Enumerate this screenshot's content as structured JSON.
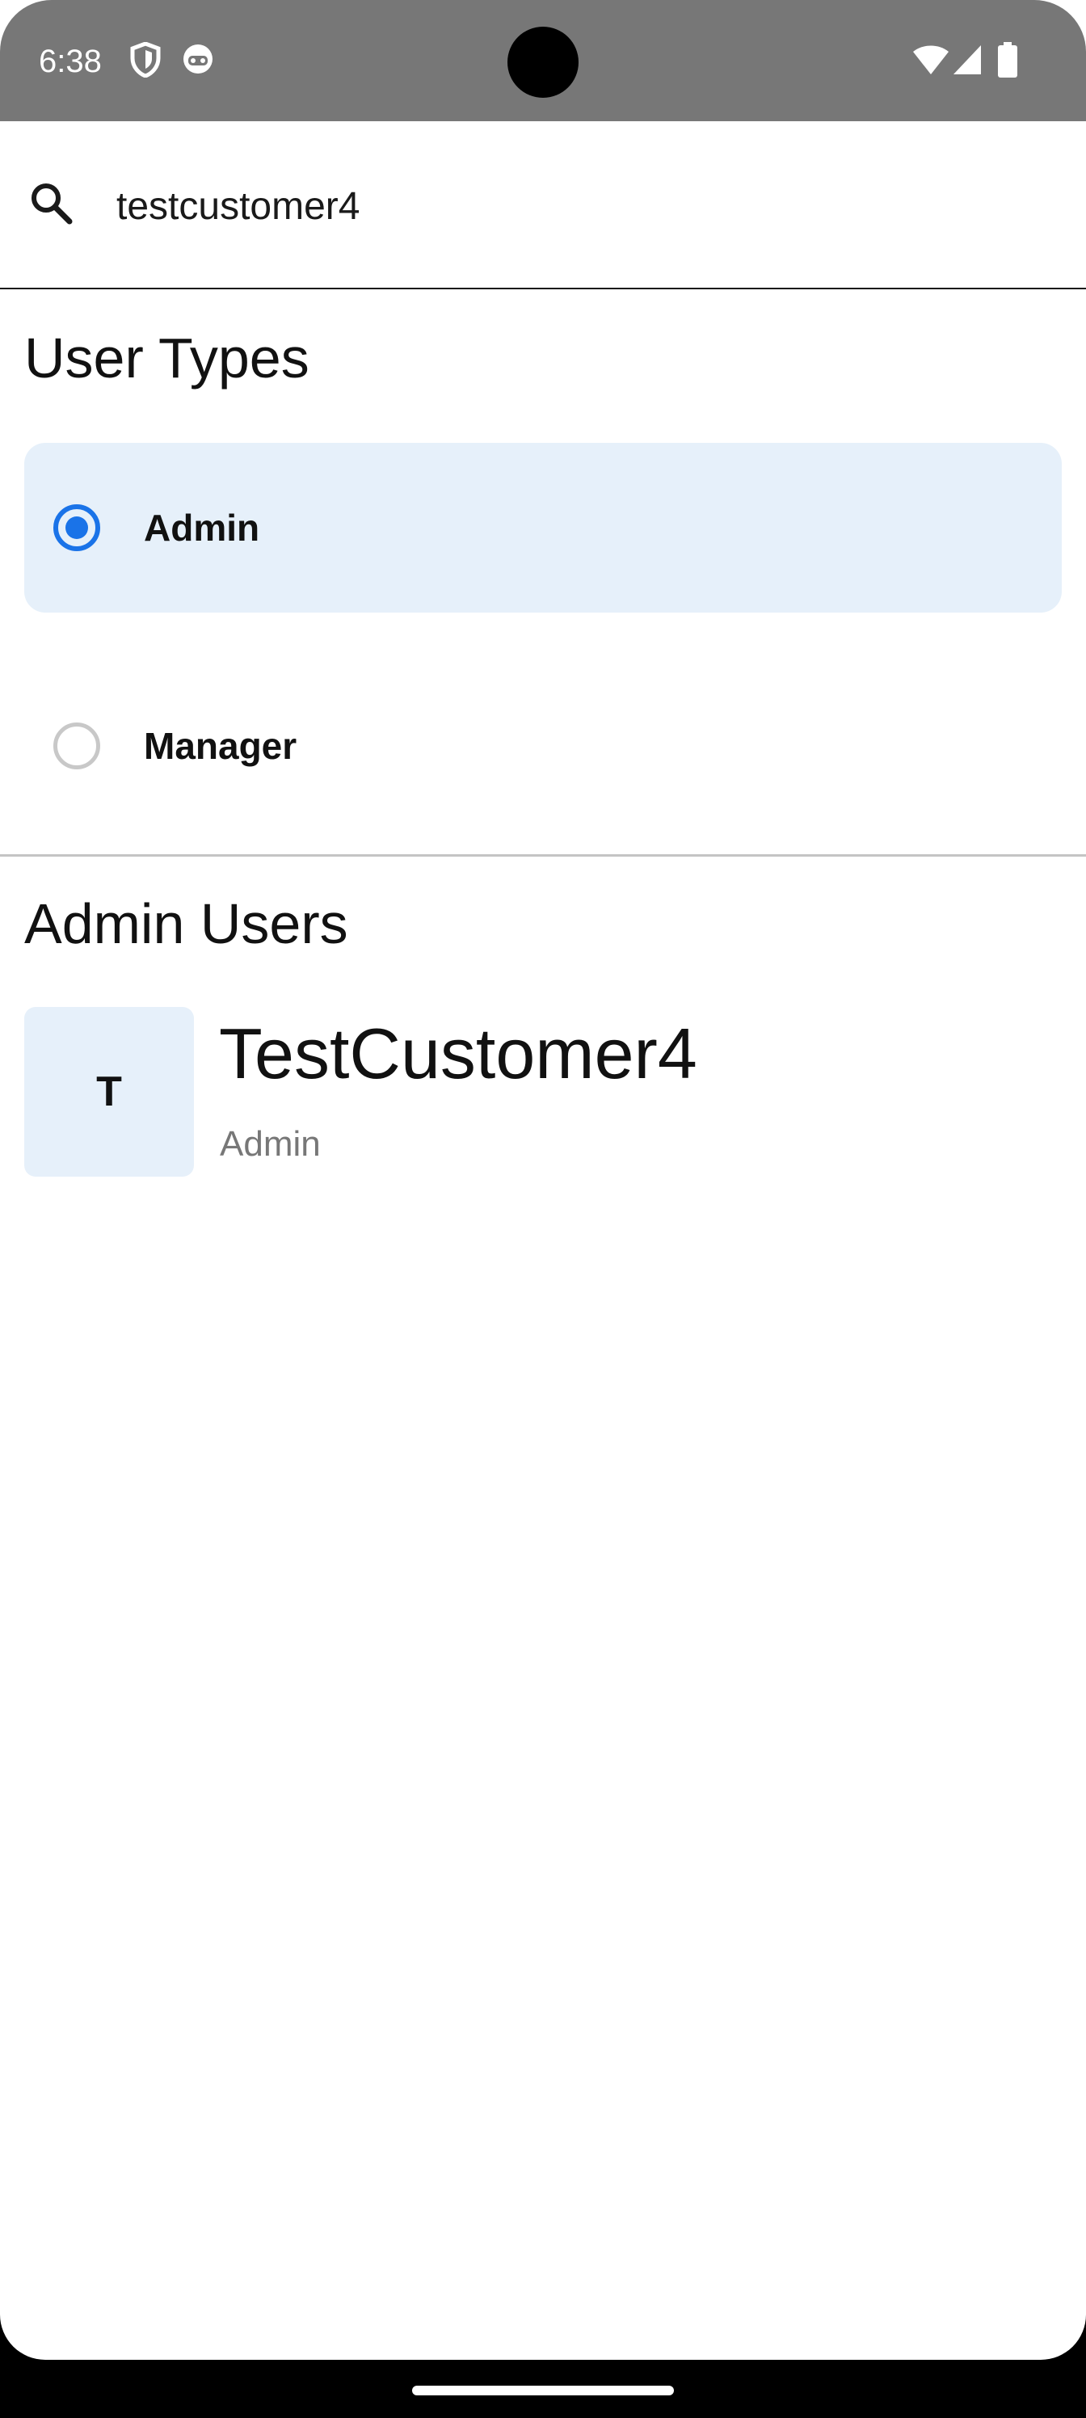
{
  "status_bar": {
    "time": "6:38",
    "icons_left": [
      "shield-icon",
      "face-icon"
    ],
    "icons_right": [
      "wifi-icon",
      "signal-icon",
      "battery-icon"
    ]
  },
  "search": {
    "value": "testcustomer4",
    "placeholder": ""
  },
  "user_types": {
    "title": "User Types",
    "options": [
      {
        "label": "Admin",
        "selected": true
      },
      {
        "label": "Manager",
        "selected": false
      }
    ]
  },
  "users_section": {
    "title": "Admin Users",
    "users": [
      {
        "initial": "T",
        "name": "TestCustomer4",
        "role": "Admin"
      }
    ]
  },
  "colors": {
    "accent": "#1a73e8",
    "selected_bg": "#e6f0fa",
    "status_bar": "#777777"
  }
}
